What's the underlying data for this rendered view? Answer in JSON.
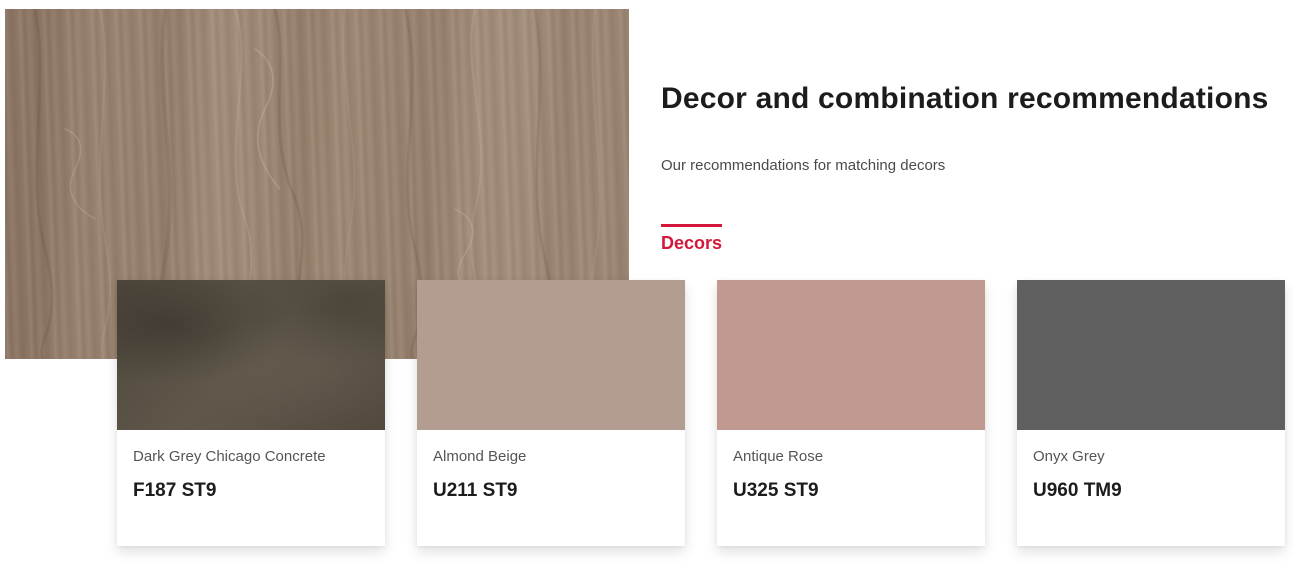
{
  "section": {
    "title": "Decor and combination recommendations",
    "subtitle": "Our recommendations for matching decors",
    "tab_label": "Decors"
  },
  "colors": {
    "accent": "#d4173a",
    "hero_wood": "#9c8572"
  },
  "cards": [
    {
      "name": "Dark Grey Chicago Concrete",
      "code": "F187 ST9",
      "swatch_color": "#5a5246"
    },
    {
      "name": "Almond Beige",
      "code": "U211 ST9",
      "swatch_color": "#b39d90"
    },
    {
      "name": "Antique Rose",
      "code": "U325 ST9",
      "swatch_color": "#c09a90"
    },
    {
      "name": "Onyx Grey",
      "code": "U960 TM9",
      "swatch_color": "#5f5f5f"
    }
  ]
}
